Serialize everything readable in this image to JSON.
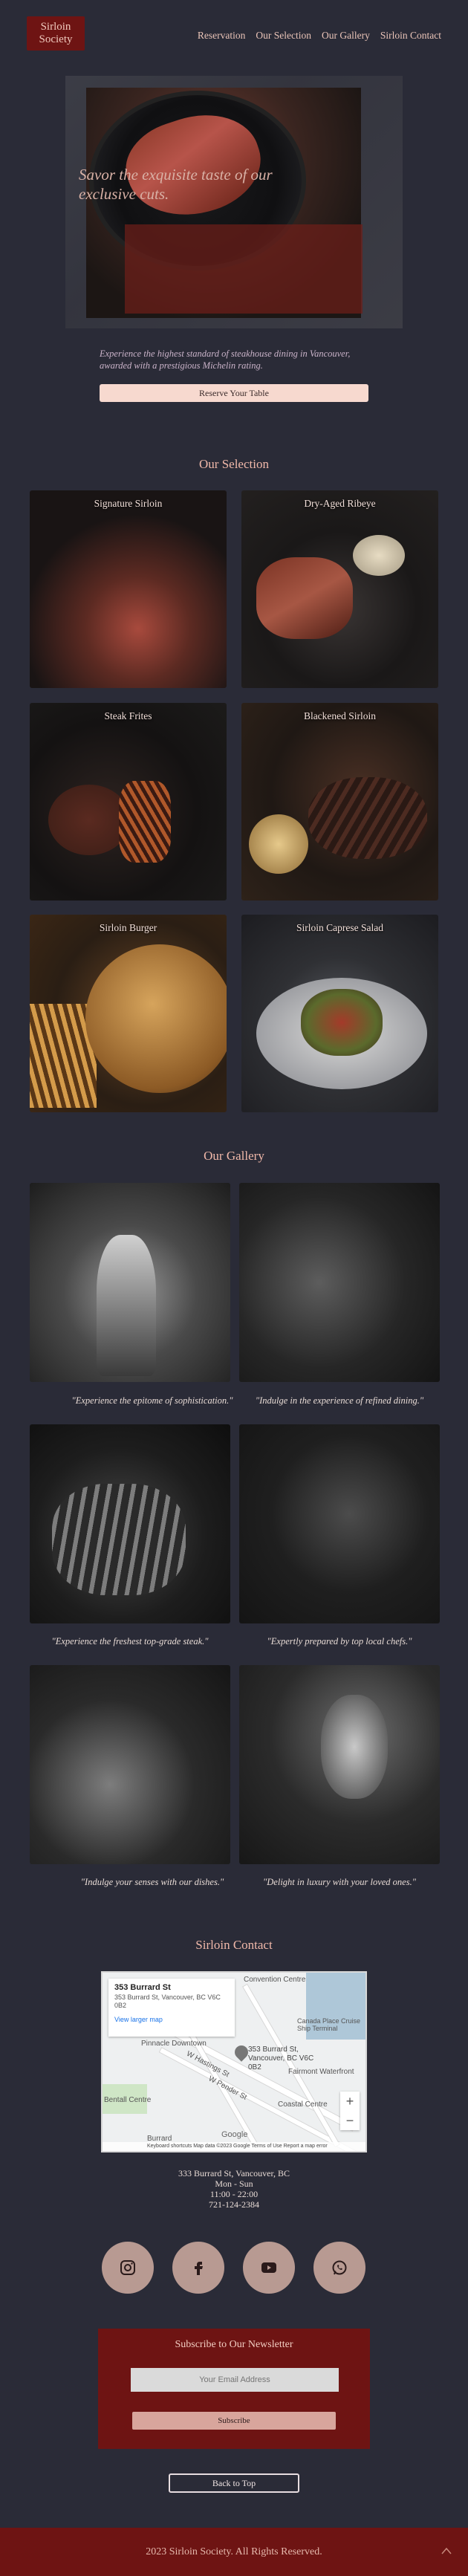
{
  "nav": {
    "logo": "Sirloin Society",
    "items": [
      "Reservation",
      "Our Selection",
      "Our Gallery",
      "Sirloin Contact"
    ]
  },
  "hero": {
    "title": "Savor the exquisite taste of our exclusive cuts.",
    "subtitle": "Experience the highest standard of steakhouse dining in Vancouver, awarded with a prestigious Michelin rating.",
    "cta": "Reserve Your Table"
  },
  "selection": {
    "title": "Our Selection",
    "items": [
      "Signature Sirloin",
      "Dry-Aged Ribeye",
      "Steak Frites",
      "Blackened Sirloin",
      "Sirloin Burger",
      "Sirloin Caprese Salad"
    ]
  },
  "gallery": {
    "title": "Our Gallery",
    "captions": [
      "\"Experience the epitome of sophistication.\"",
      "\"Indulge in the experience of refined dining.\"",
      "\"Experience the freshest top-grade steak.\"",
      "\"Expertly prepared by top local chefs.\"",
      "\"Indulge your senses with our dishes.\"",
      "\"Delight in luxury with your loved ones.\""
    ]
  },
  "contact": {
    "title": "Sirloin Contact",
    "map": {
      "place_title": "353 Burrard St",
      "place_address": "353 Burrard St, Vancouver, BC V6C 0B2",
      "view_larger": "View larger map",
      "pin_label": "353 Burrard St, Vancouver, BC V6C 0B2",
      "labels": [
        "Convention Centre",
        "Canada Place Cruise Ship Terminal",
        "Pinnacle Downtown",
        "Fairmont Waterfront",
        "Coastal Centre",
        "Bentall Centre",
        "W Hastings St",
        "W Pender St",
        "Burrard",
        "Google"
      ],
      "attribution": "Keyboard shortcuts   Map data ©2023 Google   Terms of Use   Report a map error",
      "zoom_in": "+",
      "zoom_out": "−"
    },
    "address": "333 Burrard St, Vancouver, BC",
    "hours_days": "Mon - Sun",
    "hours_time": "11:00 - 22:00",
    "phone": "721-124-2384"
  },
  "socials": [
    "instagram-icon",
    "facebook-icon",
    "youtube-icon",
    "whatsapp-icon"
  ],
  "newsletter": {
    "title": "Subscribe to Our Newsletter",
    "placeholder": "Your Email Address",
    "button": "Subscribe"
  },
  "back_to_top": "Back to Top",
  "footer": "2023 Sirloin Society. All Rights Reserved.",
  "colors": {
    "background": "#2a2b37",
    "brand": "#6e1413",
    "accent": "#f7d9cf"
  }
}
